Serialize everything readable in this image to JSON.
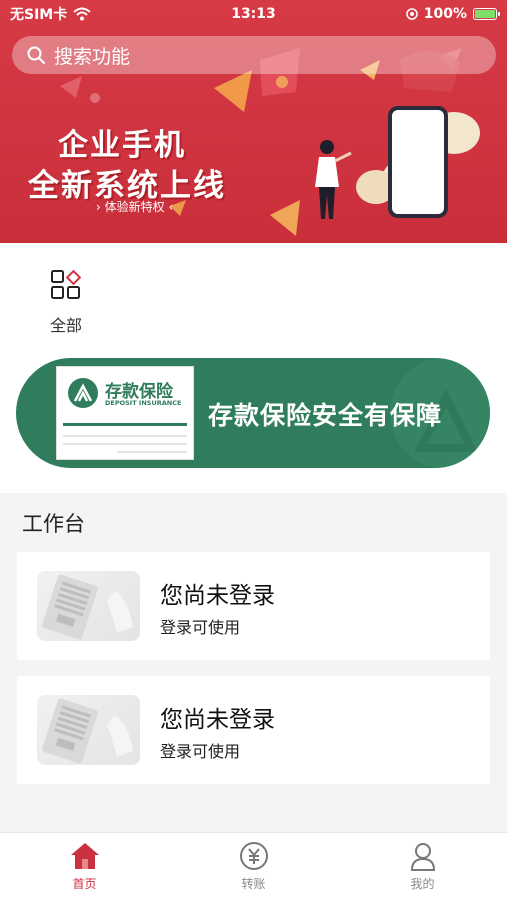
{
  "status_bar": {
    "carrier": "无SIM卡",
    "time": "13:13",
    "battery": "100%"
  },
  "search": {
    "placeholder": "搜索功能"
  },
  "banner": {
    "title_line1": "企业手机",
    "title_line2": "全新系统上线",
    "subtitle": "体验新特权"
  },
  "quick_entry": {
    "label": "全部",
    "icon": "grid-icon"
  },
  "deposit_banner": {
    "card_title": "存款保险",
    "card_english": "DEPOSIT INSURANCE",
    "slogan": "存款保险安全有保障"
  },
  "workbench": {
    "title": "工作台",
    "cards": [
      {
        "title": "您尚未登录",
        "subtitle": "登录可使用"
      },
      {
        "title": "您尚未登录",
        "subtitle": "登录可使用"
      }
    ]
  },
  "tabbar": {
    "items": [
      {
        "label": "首页",
        "icon": "home-icon",
        "active": true
      },
      {
        "label": "转账",
        "icon": "transfer-icon",
        "active": false
      },
      {
        "label": "我的",
        "icon": "user-icon",
        "active": false
      }
    ]
  },
  "colors": {
    "brand_red": "#c9323e",
    "deposit_green": "#2f7d5c"
  }
}
